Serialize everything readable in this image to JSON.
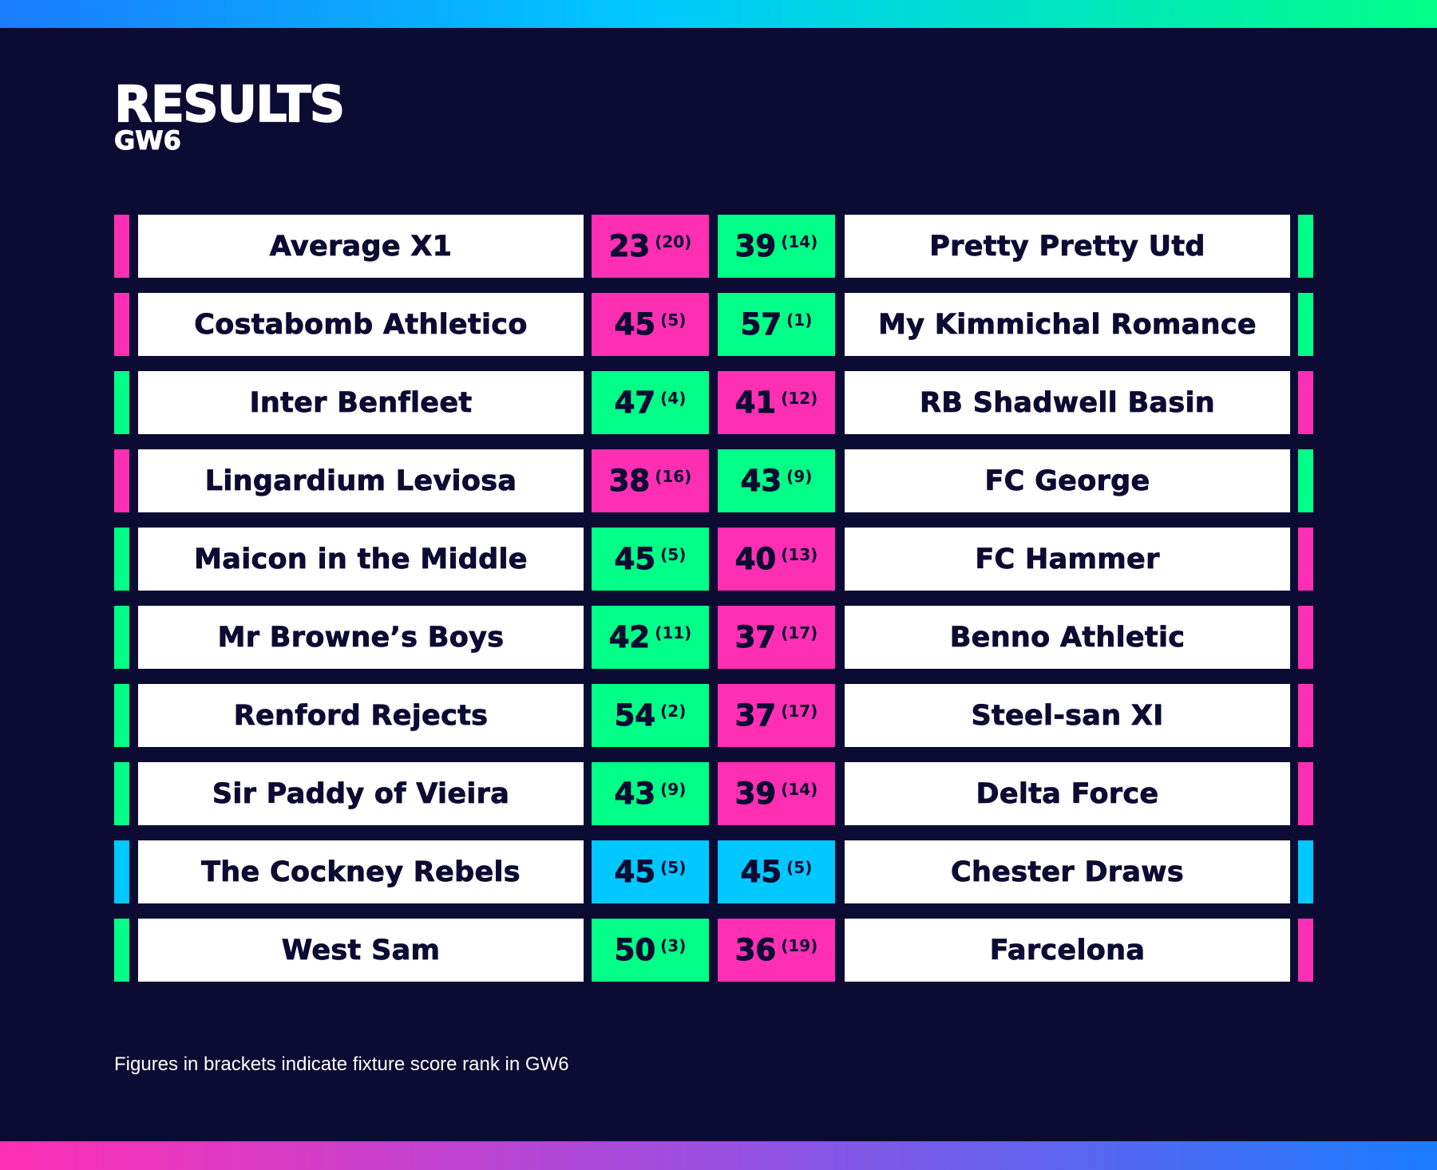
{
  "header": {
    "title": "RESULTS",
    "subtitle": "GW6"
  },
  "colors": {
    "background": "#0b0b33",
    "win": "#00ff87",
    "loss": "#ff2fb3",
    "draw": "#00c8ff",
    "team_box": "#ffffff",
    "text_dark": "#0b0b33"
  },
  "fixtures": [
    {
      "home": "Average X1",
      "home_score": "23",
      "home_rank": "(20)",
      "home_result": "loss",
      "away": "Pretty Pretty Utd",
      "away_score": "39",
      "away_rank": "(14)",
      "away_result": "win"
    },
    {
      "home": "Costabomb Athletico",
      "home_score": "45",
      "home_rank": "(5)",
      "home_result": "loss",
      "away": "My Kimmichal Romance",
      "away_score": "57",
      "away_rank": "(1)",
      "away_result": "win"
    },
    {
      "home": "Inter Benfleet",
      "home_score": "47",
      "home_rank": "(4)",
      "home_result": "win",
      "away": "RB Shadwell Basin",
      "away_score": "41",
      "away_rank": "(12)",
      "away_result": "loss"
    },
    {
      "home": "Lingardium Leviosa",
      "home_score": "38",
      "home_rank": "(16)",
      "home_result": "loss",
      "away": "FC George",
      "away_score": "43",
      "away_rank": "(9)",
      "away_result": "win"
    },
    {
      "home": "Maicon in the Middle",
      "home_score": "45",
      "home_rank": "(5)",
      "home_result": "win",
      "away": "FC Hammer",
      "away_score": "40",
      "away_rank": "(13)",
      "away_result": "loss"
    },
    {
      "home": "Mr Browne’s Boys",
      "home_score": "42",
      "home_rank": "(11)",
      "home_result": "win",
      "away": "Benno Athletic",
      "away_score": "37",
      "away_rank": "(17)",
      "away_result": "loss"
    },
    {
      "home": "Renford Rejects",
      "home_score": "54",
      "home_rank": "(2)",
      "home_result": "win",
      "away": "Steel-san XI",
      "away_score": "37",
      "away_rank": "(17)",
      "away_result": "loss"
    },
    {
      "home": "Sir Paddy of Vieira",
      "home_score": "43",
      "home_rank": "(9)",
      "home_result": "win",
      "away": "Delta Force",
      "away_score": "39",
      "away_rank": "(14)",
      "away_result": "loss"
    },
    {
      "home": "The Cockney Rebels",
      "home_score": "45",
      "home_rank": "(5)",
      "home_result": "draw",
      "away": "Chester Draws",
      "away_score": "45",
      "away_rank": "(5)",
      "away_result": "draw"
    },
    {
      "home": "West Sam",
      "home_score": "50",
      "home_rank": "(3)",
      "home_result": "win",
      "away": "Farcelona",
      "away_score": "36",
      "away_rank": "(19)",
      "away_result": "loss"
    }
  ],
  "footnote": "Figures in brackets indicate fixture score rank in GW6"
}
